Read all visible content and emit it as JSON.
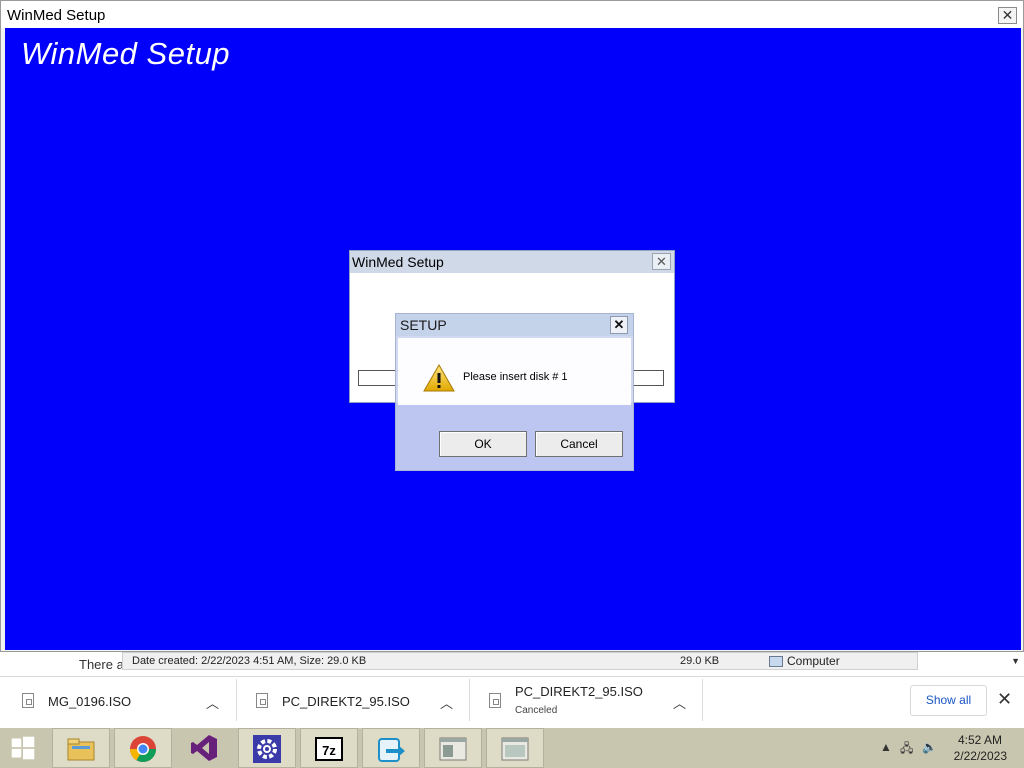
{
  "main_window": {
    "title": "WinMed Setup",
    "close_glyph": "✕",
    "brand_text": "WinMed Setup",
    "background_color": "#0000fb"
  },
  "setup_dialog": {
    "title": "WinMed Setup",
    "close_glyph": "✕"
  },
  "message_box": {
    "title": "SETUP",
    "close_glyph": "✕",
    "icon": "warning-icon",
    "message": "Please insert disk # 1",
    "ok_label": "OK",
    "cancel_label": "Cancel"
  },
  "background_window": {
    "text_fragment": "There a",
    "status_details": "Date created: 2/22/2023 4:51 AM, Size: 29.0 KB",
    "size": "29.0 KB",
    "location": "Computer"
  },
  "downloads": {
    "items": [
      {
        "name": "MG_0196.ISO",
        "status": ""
      },
      {
        "name": "PC_DIREKT2_95.ISO",
        "status": ""
      },
      {
        "name": "PC_DIREKT2_95.ISO",
        "status": "Canceled"
      }
    ],
    "show_all_label": "Show all",
    "close_glyph": "✕"
  },
  "taskbar": {
    "apps": [
      "windows-start",
      "file-explorer",
      "chrome",
      "visual-studio",
      "settings",
      "7-zip",
      "installer",
      "window-a",
      "window-b"
    ],
    "clock_time": "4:52 AM",
    "clock_date": "2/22/2023"
  }
}
